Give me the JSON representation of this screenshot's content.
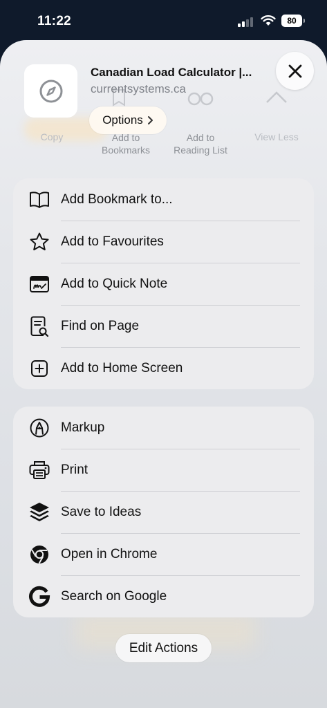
{
  "status": {
    "time": "11:22",
    "battery": "80"
  },
  "site": {
    "title": "Canadian Load Calculator |...",
    "url": "currentsystems.ca"
  },
  "options_label": "Options",
  "background_hints": {
    "copy": "Copy",
    "bookmarks": "Add to\nBookmarks",
    "reading_list": "Add to\nReading List",
    "view_less": "View Less"
  },
  "actions_group1": [
    {
      "label": "Add Bookmark to...",
      "icon": "book-icon"
    },
    {
      "label": "Add to Favourites",
      "icon": "star-icon"
    },
    {
      "label": "Add to Quick Note",
      "icon": "quick-note-icon"
    },
    {
      "label": "Find on Page",
      "icon": "find-on-page-icon"
    },
    {
      "label": "Add to Home Screen",
      "icon": "plus-square-icon"
    }
  ],
  "actions_group2": [
    {
      "label": "Markup",
      "icon": "markup-pen-icon"
    },
    {
      "label": "Print",
      "icon": "printer-icon"
    },
    {
      "label": "Save to Ideas",
      "icon": "layers-icon"
    },
    {
      "label": "Open in Chrome",
      "icon": "chrome-icon"
    },
    {
      "label": "Search on Google",
      "icon": "google-icon"
    }
  ],
  "edit_actions_label": "Edit Actions"
}
